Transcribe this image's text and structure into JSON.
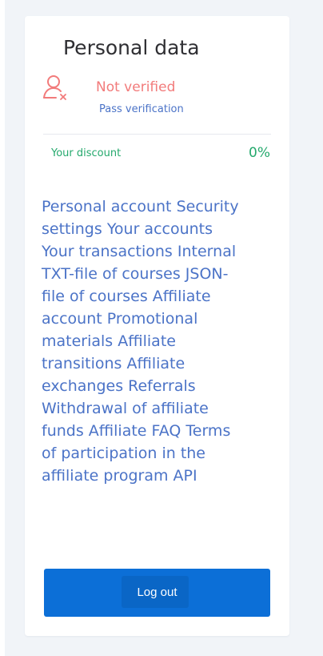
{
  "card": {
    "title": "Personal data",
    "status": "Not verified",
    "verify_link": "Pass verification",
    "discount_label": "Your discount",
    "discount_value": "0%"
  },
  "menu": [
    "Personal account",
    "Security settings",
    "Your accounts",
    "Your transactions",
    "Internal TXT-file of courses",
    "JSON-file of courses",
    "Affiliate account",
    "Promotional materials",
    "Affiliate transitions",
    "Affiliate exchanges",
    "Referrals",
    "Withdrawal of affiliate funds",
    "Affiliate FAQ",
    "Terms of participation in the affiliate program",
    "API"
  ],
  "logout_label": "Log out",
  "colors": {
    "link": "#4b73c7",
    "unverified": "#f27b7b",
    "discount": "#25a96d",
    "button": "#0c6fd7"
  },
  "icons": {
    "user_status": "user-unverified-icon"
  }
}
